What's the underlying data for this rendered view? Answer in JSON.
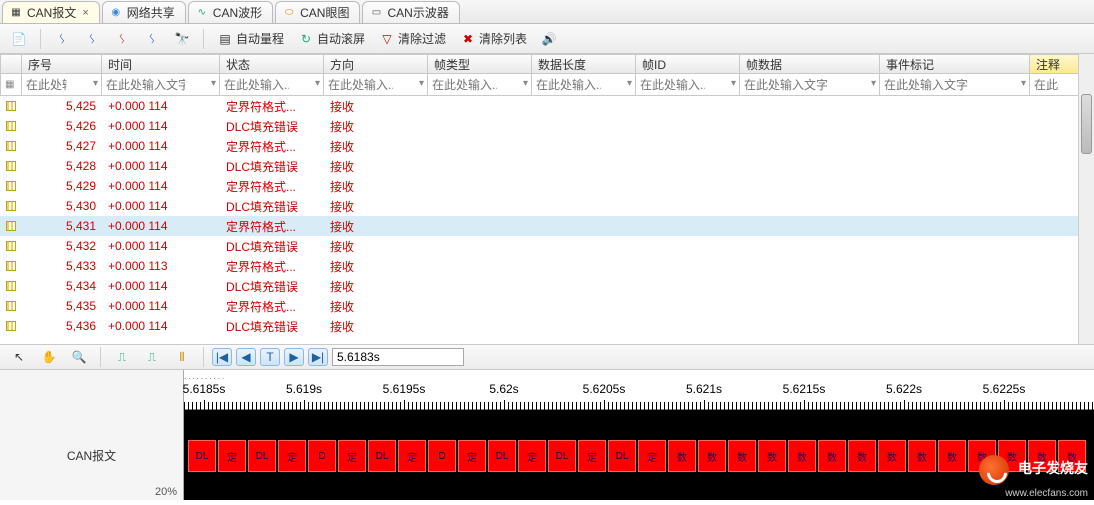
{
  "tabs": [
    {
      "label": "CAN报文",
      "active": true,
      "closable": true
    },
    {
      "label": "网络共享"
    },
    {
      "label": "CAN波形"
    },
    {
      "label": "CAN眼图"
    },
    {
      "label": "CAN示波器"
    }
  ],
  "toolbar": {
    "auto_range": "自动量程",
    "auto_scroll": "自动滚屏",
    "clear_filter": "清除过滤",
    "clear_list": "清除列表"
  },
  "columns": [
    "",
    "序号",
    "时间",
    "状态",
    "方向",
    "帧类型",
    "数据长度",
    "帧ID",
    "帧数据",
    "事件标记",
    "注释"
  ],
  "filter_placeholder": "在此处输入文字",
  "filter_short": "在此处输入...",
  "rows": [
    {
      "seq": "5,425",
      "time": "+0.000 114",
      "state": "定界符格式...",
      "dir": "接收"
    },
    {
      "seq": "5,426",
      "time": "+0.000 114",
      "state": "DLC填充错误",
      "dir": "接收"
    },
    {
      "seq": "5,427",
      "time": "+0.000 114",
      "state": "定界符格式...",
      "dir": "接收"
    },
    {
      "seq": "5,428",
      "time": "+0.000 114",
      "state": "DLC填充错误",
      "dir": "接收"
    },
    {
      "seq": "5,429",
      "time": "+0.000 114",
      "state": "定界符格式...",
      "dir": "接收"
    },
    {
      "seq": "5,430",
      "time": "+0.000 114",
      "state": "DLC填充错误",
      "dir": "接收"
    },
    {
      "seq": "5,431",
      "time": "+0.000 114",
      "state": "定界符格式...",
      "dir": "接收",
      "selected": true
    },
    {
      "seq": "5,432",
      "time": "+0.000 114",
      "state": "DLC填充错误",
      "dir": "接收"
    },
    {
      "seq": "5,433",
      "time": "+0.000 113",
      "state": "定界符格式...",
      "dir": "接收"
    },
    {
      "seq": "5,434",
      "time": "+0.000 114",
      "state": "DLC填充错误",
      "dir": "接收"
    },
    {
      "seq": "5,435",
      "time": "+0.000 114",
      "state": "定界符格式...",
      "dir": "接收"
    },
    {
      "seq": "5,436",
      "time": "+0.000 114",
      "state": "DLC填充错误",
      "dir": "接收"
    }
  ],
  "timeline": {
    "value": "5.6183s",
    "ticks": [
      "5.6185s",
      "5.619s",
      "5.6195s",
      "5.62s",
      "5.6205s",
      "5.621s",
      "5.6215s",
      "5.622s",
      "5.6225s"
    ],
    "track_label": "CAN报文",
    "zoom_pct": "20%",
    "blocks": [
      "DL",
      "定",
      "DL",
      "定",
      "D",
      "定",
      "DL",
      "定",
      "D",
      "定",
      "DL",
      "定",
      "DL",
      "定",
      "DL",
      "定",
      "数",
      "数",
      "数",
      "数",
      "数",
      "数",
      "数",
      "数",
      "数",
      "数",
      "数",
      "数",
      "数",
      "数"
    ]
  },
  "watermark": {
    "line1": "电子发烧友",
    "line2": "www.elecfans.com"
  }
}
